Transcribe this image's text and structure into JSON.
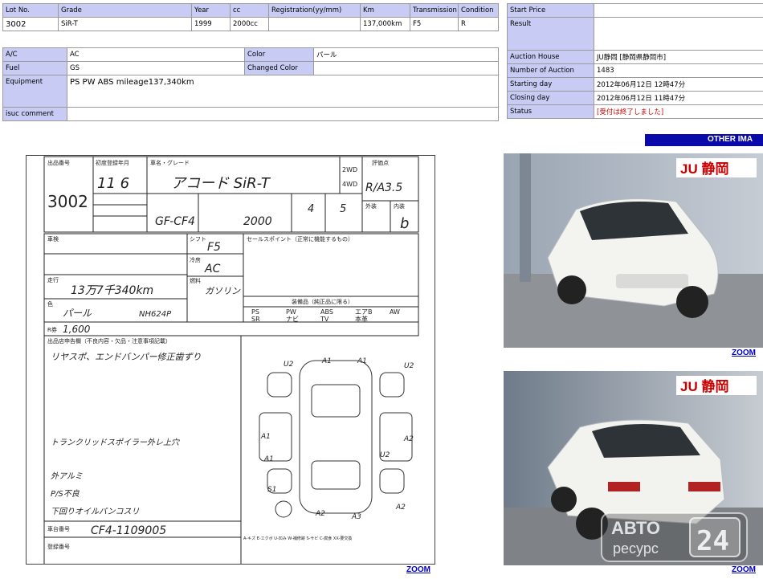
{
  "lot_table": {
    "headers": [
      "Lot No.",
      "Grade",
      "Year",
      "cc",
      "Registration(yy/mm)",
      "Km",
      "Transmission",
      "Condition"
    ],
    "values": [
      "3002",
      "SiR-T",
      "1999",
      "2000cc",
      "",
      "137,000km",
      "F5",
      "R"
    ]
  },
  "spec_table": {
    "ac_label": "A/C",
    "ac_value": "AC",
    "color_label": "Color",
    "color_value": "パール",
    "fuel_label": "Fuel",
    "fuel_value": "GS",
    "changed_color_label": "Changed Color",
    "changed_color_value": "",
    "equipment_label": "Equipment",
    "equipment_value": "PS PW ABS  mileage137,340km",
    "comment_label": "isuc comment",
    "comment_value": ""
  },
  "status_table": {
    "start_price_label": "Start Price",
    "start_price_value": "",
    "result_label": "Result",
    "result_value": "",
    "auction_house_label": "Auction House",
    "auction_house_value": "JU静岡 [静岡県静岡市]",
    "number_label": "Number of Auction",
    "number_value": "1483",
    "starting_day_label": "Starting day",
    "starting_day_value": "2012年06月12日 12時47分",
    "closing_day_label": "Closing day",
    "closing_day_value": "2012年06月12日 11時47分",
    "status_label": "Status",
    "status_value": "[受付は終了しました]"
  },
  "other_images_label": "OTHER IMA",
  "zoom_label": "ZOOM",
  "sheet": {
    "lot_no_label": "出品番号",
    "lot_no": "3002",
    "first_reg_label": "初度登録年月",
    "first_reg": "11  6",
    "model_label": "車名・グレード",
    "model": "アコード   SiR-T",
    "drive_2wd": "2WD",
    "drive_4wd": "4WD",
    "score_label": "評価点",
    "score": "R/A3.5",
    "type_code": "GF-CF4",
    "displacement": "2000",
    "doors": "4",
    "capacity": "5",
    "exterior_label": "外装",
    "interior_label": "内装",
    "interior_grade": "b",
    "inspection_label": "車検",
    "shift_label": "シフト",
    "shift": "F5",
    "ac_label": "冷房",
    "ac": "AC",
    "mileage_label": "走行",
    "mileage": "13万7千340km",
    "fuel_label": "燃料",
    "fuel": "ガソリン",
    "color_label": "色",
    "color": "パール",
    "color_code": "NH624P",
    "selling_points_label": "セールスポイント（正常に機能するもの）",
    "options_label": "装備品（純正品に限る）",
    "options": [
      "PS",
      "PW",
      "ABS",
      "エアB",
      "AW",
      "SR",
      "ナビ",
      "TV",
      "本革"
    ],
    "recycle_label": "R券",
    "recycle": "1,600",
    "report_label": "出品店申告欄（不良内容・欠品・注意事項記載）",
    "notes": [
      "リヤスポ、エンドバンパー修正歯ずり",
      "トランクリッドスポイラー外レ上穴",
      "外アルミ",
      "P/S不良",
      "下回りオイルパンコスリ"
    ],
    "chassis_label": "車台番号",
    "chassis": "CF4-1109005",
    "registration_label": "登録番号",
    "legend": "A-キズ E-エクボ U-凹み W-補修跡 S-サビ C-腐食 XX-要交換",
    "damage_marks": [
      "U2",
      "A1",
      "A1",
      "U2",
      "A1",
      "A1",
      "A2",
      "U2",
      "S1",
      "A2",
      "A3",
      "A2"
    ]
  },
  "photo_brand": "JU 静岡",
  "watermark": {
    "line1": "АВТО",
    "line2": "ресурс",
    "number": "24"
  },
  "colors": {
    "label_bg": "#c8ccf4",
    "bar_bg": "#0a0aaa",
    "status_red": "#cc0000",
    "zoom_link": "#0000cc"
  }
}
